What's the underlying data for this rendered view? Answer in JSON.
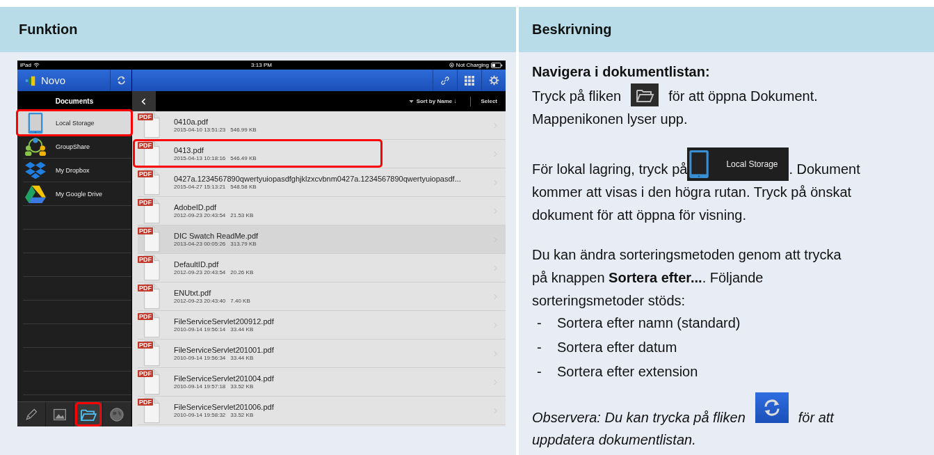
{
  "table": {
    "columns": [
      "Funktion",
      "Beskrivning"
    ]
  },
  "device": {
    "status_bar": {
      "carrier": "iPad",
      "time": "3:13 PM",
      "battery_text": "Not Charging"
    },
    "app_title": "Novo",
    "sidebar": {
      "title": "Documents",
      "items": [
        {
          "label": "Local Storage",
          "kind": "device",
          "selected": true,
          "highlighted": true
        },
        {
          "label": "GroupShare",
          "kind": "share",
          "selected": false,
          "highlighted": false
        },
        {
          "label": "My Dropbox",
          "kind": "dropbox",
          "selected": false,
          "highlighted": false
        },
        {
          "label": "My Google Drive",
          "kind": "gdrive",
          "selected": false,
          "highlighted": false
        }
      ]
    },
    "toolbar": {
      "sort": "Sort by Name ↓",
      "select": "Select"
    },
    "files": [
      {
        "name": "0410a.pdf",
        "date": "2015-04-10 13:51:23",
        "size": "546.99 KB",
        "badge": "PDF",
        "selected": false,
        "highlighted": false
      },
      {
        "name": "0413.pdf",
        "date": "2015-04-13 10:18:16",
        "size": "546.49 KB",
        "badge": "PDF",
        "selected": false,
        "highlighted": true
      },
      {
        "name": "0427a.1234567890qwertyuiopasdfghjklzxcvbnm0427a.1234567890qwertyuiopasdf...",
        "date": "2015-04-27 15:13:21",
        "size": "548.58 KB",
        "badge": "PDF",
        "selected": false,
        "highlighted": false
      },
      {
        "name": "AdobeID.pdf",
        "date": "2012-09-23 20:43:54",
        "size": "21.53 KB",
        "badge": "PDF",
        "selected": false,
        "highlighted": false
      },
      {
        "name": "DIC Swatch ReadMe.pdf",
        "date": "2013-04-23 00:05:26",
        "size": "313.79 KB",
        "badge": "PDF",
        "selected": true,
        "highlighted": false
      },
      {
        "name": "DefaultID.pdf",
        "date": "2012-09-23 20:43:54",
        "size": "20.26 KB",
        "badge": "PDF",
        "selected": false,
        "highlighted": false
      },
      {
        "name": "ENUtxt.pdf",
        "date": "2012-09-23 20:43:40",
        "size": "7.40 KB",
        "badge": "PDF",
        "selected": false,
        "highlighted": false
      },
      {
        "name": "FileServiceServlet200912.pdf",
        "date": "2010-09-14 19:56:14",
        "size": "33.44 KB",
        "badge": "PDF",
        "selected": false,
        "highlighted": false
      },
      {
        "name": "FileServiceServlet201001.pdf",
        "date": "2010-09-14 19:56:34",
        "size": "33.44 KB",
        "badge": "PDF",
        "selected": false,
        "highlighted": false
      },
      {
        "name": "FileServiceServlet201004.pdf",
        "date": "2010-09-14 19:57:18",
        "size": "33.52 KB",
        "badge": "PDF",
        "selected": false,
        "highlighted": false
      },
      {
        "name": "FileServiceServlet201006.pdf",
        "date": "2010-09-14 19:58:32",
        "size": "33.52 KB",
        "badge": "PDF",
        "selected": false,
        "highlighted": false
      }
    ],
    "tabs": [
      {
        "kind": "pen",
        "selected": false,
        "highlighted": false
      },
      {
        "kind": "photo",
        "selected": false,
        "highlighted": false
      },
      {
        "kind": "folder",
        "selected": true,
        "highlighted": true
      },
      {
        "kind": "globe",
        "selected": false,
        "highlighted": false
      }
    ]
  },
  "description": {
    "blocks": [
      {
        "kind": "heading",
        "text": "Navigera i dokumentlistan:"
      },
      {
        "kind": "paragraph",
        "lines": [
          [
            {
              "kind": "text",
              "text": "Tryck på fliken"
            },
            {
              "kind": "folder_tab"
            },
            {
              "kind": "text",
              "text": "för att öppna Dokument."
            }
          ],
          [
            {
              "kind": "text",
              "text": "Mappenikonen lyser upp."
            }
          ]
        ]
      },
      {
        "kind": "paragraph",
        "lines": [
          [
            {
              "kind": "text",
              "text": "För lokal lagring, tryck på"
            },
            {
              "kind": "storage_button",
              "label": "Local Storage"
            },
            {
              "kind": "text",
              "text": ". Dokument"
            }
          ],
          [
            {
              "kind": "text",
              "text": "kommer att visas i den högra rutan. Tryck på önskat"
            }
          ],
          [
            {
              "kind": "text",
              "text": "dokument för att öppna för visning."
            }
          ]
        ]
      },
      {
        "kind": "text",
        "text": "Du kan ändra sorteringsmetoden genom att trycka på knappen **Sortera efter...**. Följande sorteringsmetoder stöds:"
      },
      {
        "kind": "list",
        "items": [
          {
            "marker": "-",
            "text": "Sortera efter namn (standard)"
          },
          {
            "marker": "-",
            "text": "Sortera efter datum"
          },
          {
            "marker": "-",
            "text": "Sortera efter extension"
          }
        ]
      },
      {
        "kind": "note",
        "lines": [
          [
            {
              "kind": "text",
              "text": "Observera: Du kan trycka på fliken"
            },
            {
              "kind": "refresh_tab"
            },
            {
              "kind": "text",
              "text": "för att"
            }
          ],
          [
            {
              "kind": "text",
              "text": "uppdatera dokumentlistan."
            }
          ]
        ]
      }
    ]
  }
}
